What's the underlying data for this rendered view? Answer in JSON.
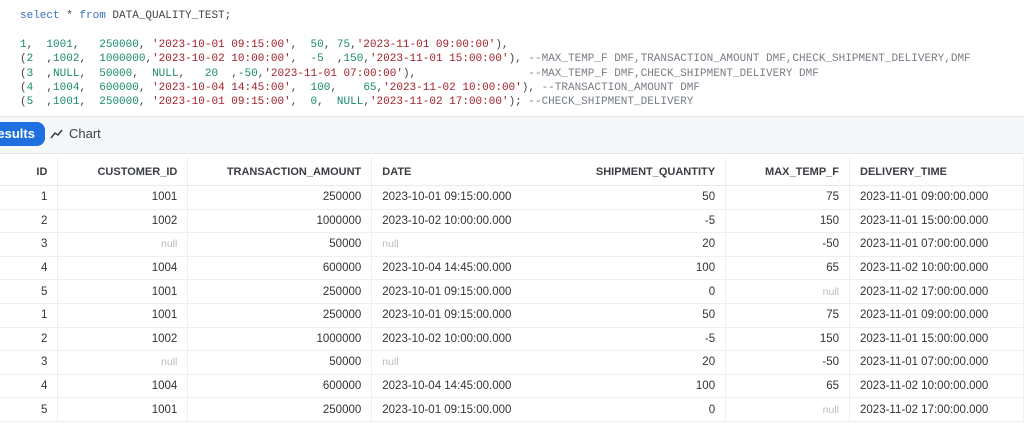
{
  "editor": {
    "lines": [
      [
        [
          "kw",
          "select"
        ],
        [
          "p",
          " * "
        ],
        [
          "kw",
          "from"
        ],
        [
          "p",
          " DATA_QUALITY_TEST;"
        ]
      ],
      [],
      [
        [
          "num",
          "1"
        ],
        [
          "p",
          ",  "
        ],
        [
          "num",
          "1001"
        ],
        [
          "p",
          ",   "
        ],
        [
          "num",
          "250000"
        ],
        [
          "p",
          ", "
        ],
        [
          "str",
          "'2023-10-01 09:15:00'"
        ],
        [
          "p",
          ",  "
        ],
        [
          "num",
          "50"
        ],
        [
          "p",
          ", "
        ],
        [
          "num",
          "75"
        ],
        [
          "p",
          ","
        ],
        [
          "str",
          "'2023-11-01 09:00:00'"
        ],
        [
          "p",
          "),"
        ]
      ],
      [
        [
          "p",
          "("
        ],
        [
          "num",
          "2"
        ],
        [
          "p",
          "  ,"
        ],
        [
          "num",
          "1002"
        ],
        [
          "p",
          ",  "
        ],
        [
          "num",
          "1000000"
        ],
        [
          "p",
          ","
        ],
        [
          "str",
          "'2023-10-02 10:00:00'"
        ],
        [
          "p",
          ",  "
        ],
        [
          "num",
          "-5"
        ],
        [
          "p",
          "  ,"
        ],
        [
          "num",
          "150"
        ],
        [
          "p",
          ","
        ],
        [
          "str",
          "'2023-11-01 15:00:00'"
        ],
        [
          "p",
          "), "
        ],
        [
          "cm",
          "--MAX_TEMP_F DMF,TRANSACTION_AMOUNT DMF,CHECK_SHIPMENT_DELIVERY,DMF"
        ]
      ],
      [
        [
          "p",
          "("
        ],
        [
          "num",
          "3"
        ],
        [
          "p",
          "  ,"
        ],
        [
          "num",
          "NULL"
        ],
        [
          "p",
          ",  "
        ],
        [
          "num",
          "50000"
        ],
        [
          "p",
          ",  "
        ],
        [
          "num",
          "NULL"
        ],
        [
          "p",
          ",   "
        ],
        [
          "num",
          "20"
        ],
        [
          "p",
          "  ,"
        ],
        [
          "num",
          "-50"
        ],
        [
          "p",
          ","
        ],
        [
          "str",
          "'2023-11-01 07:00:00'"
        ],
        [
          "p",
          "),                 "
        ],
        [
          "cm",
          "--MAX_TEMP_F DMF,CHECK_SHIPMENT_DELIVERY DMF"
        ]
      ],
      [
        [
          "p",
          "("
        ],
        [
          "num",
          "4"
        ],
        [
          "p",
          "  ,"
        ],
        [
          "num",
          "1004"
        ],
        [
          "p",
          ",  "
        ],
        [
          "num",
          "600000"
        ],
        [
          "p",
          ", "
        ],
        [
          "str",
          "'2023-10-04 14:45:00'"
        ],
        [
          "p",
          ",  "
        ],
        [
          "num",
          "100"
        ],
        [
          "p",
          ",    "
        ],
        [
          "num",
          "65"
        ],
        [
          "p",
          ","
        ],
        [
          "str",
          "'2023-11-02 10:00:00'"
        ],
        [
          "p",
          "), "
        ],
        [
          "cm",
          "--TRANSACTION_AMOUNT DMF"
        ]
      ],
      [
        [
          "p",
          "("
        ],
        [
          "num",
          "5"
        ],
        [
          "p",
          "  ,"
        ],
        [
          "num",
          "1001"
        ],
        [
          "p",
          ",  "
        ],
        [
          "num",
          "250000"
        ],
        [
          "p",
          ", "
        ],
        [
          "str",
          "'2023-10-01 09:15:00'"
        ],
        [
          "p",
          ",  "
        ],
        [
          "num",
          "0"
        ],
        [
          "p",
          ",  "
        ],
        [
          "num",
          "NULL"
        ],
        [
          "p",
          ","
        ],
        [
          "str",
          "'2023-11-02 17:00:00'"
        ],
        [
          "p",
          "); "
        ],
        [
          "cm",
          "--CHECK_SHIPMENT_DELIVERY"
        ]
      ]
    ]
  },
  "tabs": {
    "results_label": "Results",
    "chart_label": "Chart",
    "chart_icon": "line-chart-icon",
    "accent": "#1e6fe0"
  },
  "table": {
    "columns": [
      "ID",
      "CUSTOMER_ID",
      "TRANSACTION_AMOUNT",
      "DATE",
      "SHIPMENT_QUANTITY",
      "MAX_TEMP_F",
      "DELIVERY_TIME"
    ],
    "rows": [
      [
        "1",
        "1001",
        "250000",
        "2023-10-01 09:15:00.000",
        "50",
        "75",
        "2023-11-01 09:00:00.000"
      ],
      [
        "2",
        "1002",
        "1000000",
        "2023-10-02 10:00:00.000",
        "-5",
        "150",
        "2023-11-01 15:00:00.000"
      ],
      [
        "3",
        "null",
        "50000",
        "null",
        "20",
        "-50",
        "2023-11-01 07:00:00.000"
      ],
      [
        "4",
        "1004",
        "600000",
        "2023-10-04 14:45:00.000",
        "100",
        "65",
        "2023-11-02 10:00:00.000"
      ],
      [
        "5",
        "1001",
        "250000",
        "2023-10-01 09:15:00.000",
        "0",
        "null",
        "2023-11-02 17:00:00.000"
      ],
      [
        "1",
        "1001",
        "250000",
        "2023-10-01 09:15:00.000",
        "50",
        "75",
        "2023-11-01 09:00:00.000"
      ],
      [
        "2",
        "1002",
        "1000000",
        "2023-10-02 10:00:00.000",
        "-5",
        "150",
        "2023-11-01 15:00:00.000"
      ],
      [
        "3",
        "null",
        "50000",
        "null",
        "20",
        "-50",
        "2023-11-01 07:00:00.000"
      ],
      [
        "4",
        "1004",
        "600000",
        "2023-10-04 14:45:00.000",
        "100",
        "65",
        "2023-11-02 10:00:00.000"
      ],
      [
        "5",
        "1001",
        "250000",
        "2023-10-01 09:15:00.000",
        "0",
        "null",
        "2023-11-02 17:00:00.000"
      ]
    ]
  }
}
